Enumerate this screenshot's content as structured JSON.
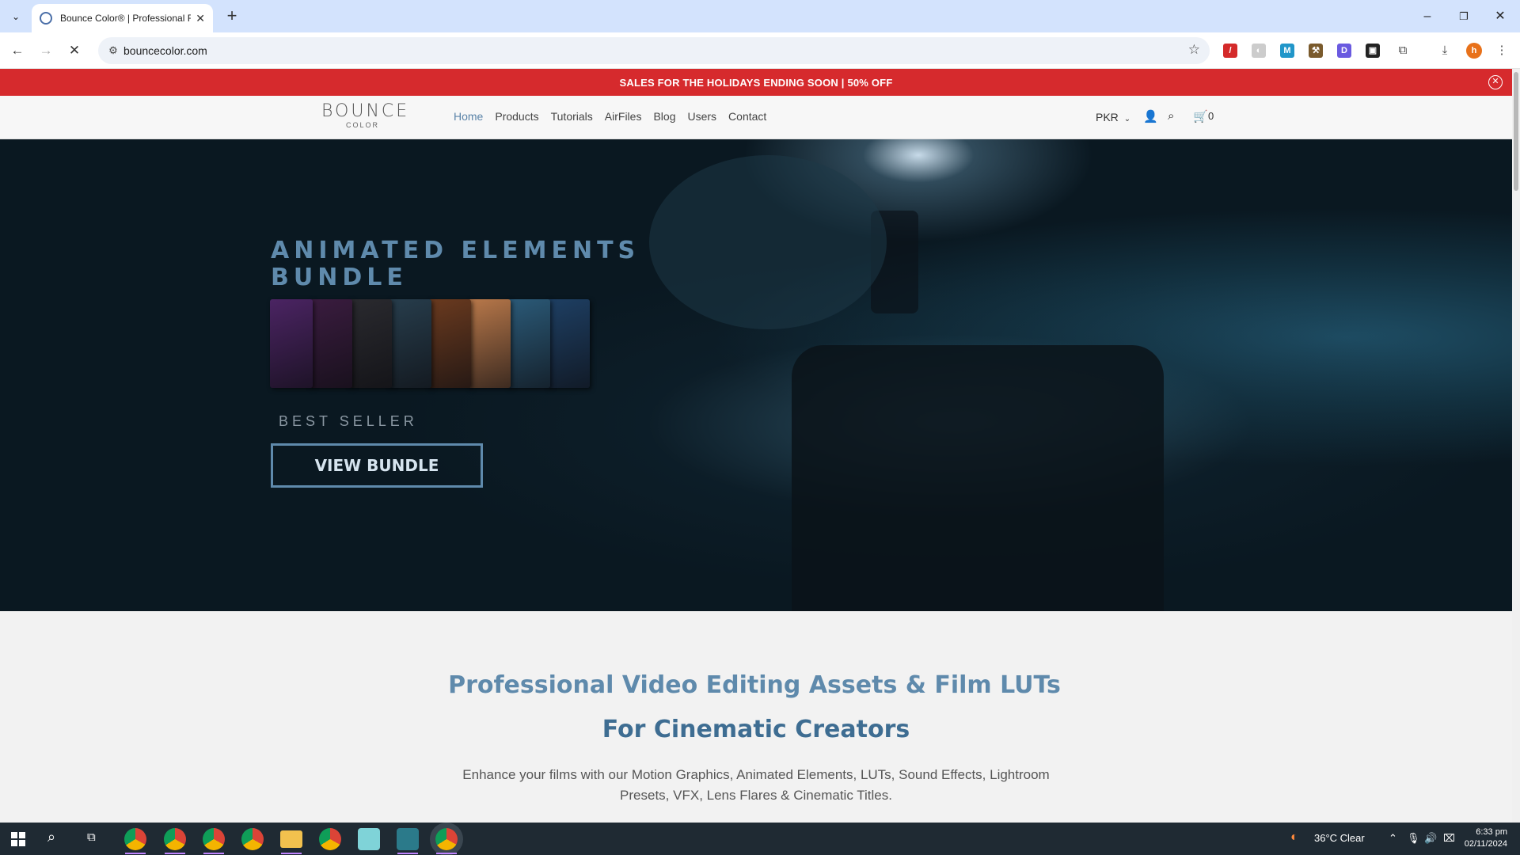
{
  "browser": {
    "tab_title": "Bounce Color® | Professional F",
    "url": "bouncecolor.com",
    "new_tab": "+",
    "minimize": "–",
    "restore": "❐",
    "close": "✕"
  },
  "promo": {
    "text": "SALES FOR THE HOLIDAYS ENDING SOON | 50% OFF",
    "bg_color": "#d62a2d"
  },
  "header": {
    "logo_main": "BOUNCE",
    "logo_sub": "COLOR",
    "nav": [
      "Home",
      "Products",
      "Tutorials",
      "AirFiles",
      "Blog",
      "Users",
      "Contact"
    ],
    "active_nav": "Home",
    "currency": "PKR",
    "cart_count": "0"
  },
  "hero": {
    "title": "ANIMATED ELEMENTS BUNDLE",
    "badge": "BEST SELLER",
    "button": "VIEW BUNDLE",
    "accent_color": "#5f8aac",
    "box_colors": [
      "#4b2463",
      "#3a1c3f",
      "#2a2a2f",
      "#273d4c",
      "#6a3a1f",
      "#b8784a",
      "#2b5a78",
      "#1e3f63"
    ]
  },
  "intro": {
    "heading_1": "Professional Video Editing Assets & Film LUTs",
    "heading_2": "For Cinematic Creators",
    "paragraph": "Enhance your films with our Motion Graphics, Animated Elements, LUTs, Sound Effects, Lightroom Presets, VFX, Lens Flares & Cinematic Titles."
  },
  "taskbar": {
    "weather": "36°C  Clear",
    "time": "6:33 pm",
    "date": "02/11/2024"
  }
}
